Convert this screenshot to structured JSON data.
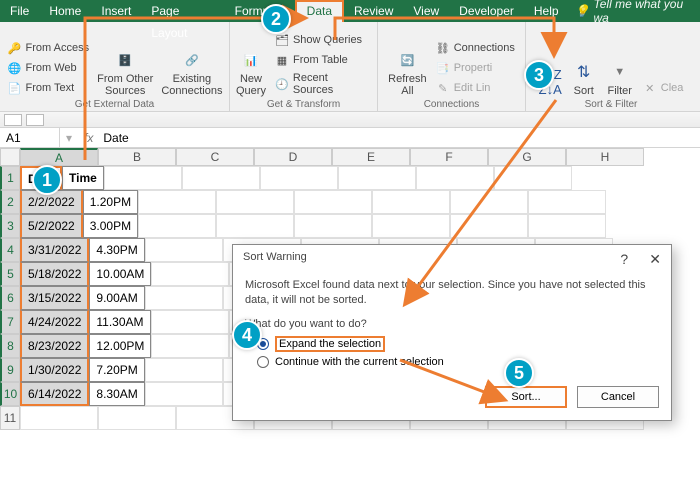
{
  "menu": {
    "tabs": [
      "File",
      "Home",
      "Insert",
      "Page Layout",
      "Formulas",
      "Data",
      "Review",
      "View",
      "Developer",
      "Help"
    ],
    "active_index": 5,
    "tell": "Tell me what you wa"
  },
  "ribbon": {
    "ext": {
      "from_access": "From Access",
      "from_web": "From Web",
      "from_text": "From Text",
      "other": "From Other\nSources",
      "existing": "Existing\nConnections",
      "name": "Get External Data"
    },
    "gt": {
      "new_query": "New\nQuery",
      "show_queries": "Show Queries",
      "from_table": "From Table",
      "recent": "Recent Sources",
      "name": "Get & Transform"
    },
    "conn": {
      "refresh": "Refresh\nAll",
      "connections": "Connections",
      "properties": "Properti",
      "edit_links": "Edit Lin",
      "name": "Connections"
    },
    "sort": {
      "sort": "Sort",
      "filter": "Filter",
      "clear": "Clea",
      "name": "Sort & Filter"
    }
  },
  "namebox": "A1",
  "formula": "Date",
  "cols": [
    "A",
    "B",
    "C",
    "D",
    "E",
    "F",
    "G",
    "H"
  ],
  "rows": [
    {
      "n": "1",
      "a": "Date",
      "b": "Time",
      "hdr": true
    },
    {
      "n": "2",
      "a": "2/2/2022",
      "b": "1.20PM"
    },
    {
      "n": "3",
      "a": "5/2/2022",
      "b": "3.00PM"
    },
    {
      "n": "4",
      "a": "3/31/2022",
      "b": "4.30PM"
    },
    {
      "n": "5",
      "a": "5/18/2022",
      "b": "10.00AM"
    },
    {
      "n": "6",
      "a": "3/15/2022",
      "b": "9.00AM"
    },
    {
      "n": "7",
      "a": "4/24/2022",
      "b": "11.30AM"
    },
    {
      "n": "8",
      "a": "8/23/2022",
      "b": "12.00PM"
    },
    {
      "n": "9",
      "a": "1/30/2022",
      "b": "7.20PM"
    },
    {
      "n": "10",
      "a": "6/14/2022",
      "b": "8.30AM"
    },
    {
      "n": "11",
      "a": "",
      "b": "",
      "blank": true
    }
  ],
  "dialog": {
    "title": "Sort Warning",
    "msg": "Microsoft Excel found data next to your selection.  Since you have not selected this data, it will not be sorted.",
    "q": "What do you want to do?",
    "opt1": "Expand the selection",
    "opt2": "Continue with the current selection",
    "sort": "Sort...",
    "cancel": "Cancel",
    "help": "?",
    "close": "✕"
  },
  "steps": [
    "1",
    "2",
    "3",
    "4",
    "5"
  ]
}
